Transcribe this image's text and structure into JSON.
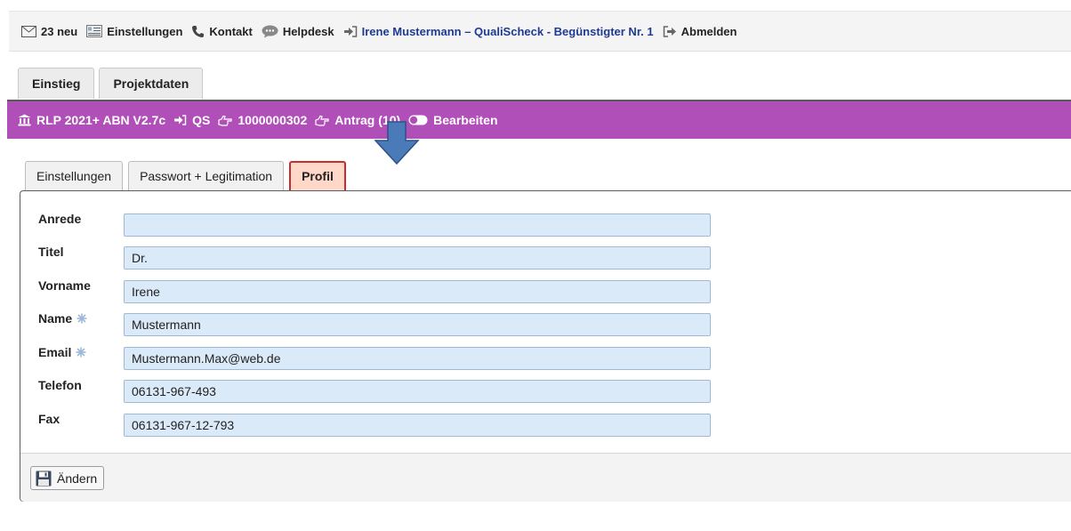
{
  "topbar": {
    "messages": "23 neu",
    "settings": "Einstellungen",
    "contact": "Kontakt",
    "helpdesk": "Helpdesk",
    "user": "Irene Mustermann – QualiScheck - Begünstigter Nr. 1",
    "logout": "Abmelden"
  },
  "top_tabs": [
    "Einstieg",
    "Projektdaten"
  ],
  "breadcrumb": {
    "program": "RLP 2021+ ABN V2.7c",
    "module": "QS",
    "number": "1000000302",
    "application": "Antrag (10)",
    "mode": "Bearbeiten"
  },
  "sub_tabs": [
    "Einstellungen",
    "Passwort + Legitimation",
    "Profil"
  ],
  "form": {
    "fields": [
      {
        "label": "Anrede",
        "value": "",
        "required": false
      },
      {
        "label": "Titel",
        "value": "Dr.",
        "required": false
      },
      {
        "label": "Vorname",
        "value": "Irene",
        "required": false
      },
      {
        "label": "Name",
        "value": "Mustermann",
        "required": true
      },
      {
        "label": "Email",
        "value": "Mustermann.Max@web.de",
        "required": true
      },
      {
        "label": "Telefon",
        "value": "06131-967-493",
        "required": false
      },
      {
        "label": "Fax",
        "value": "06131-967-12-793",
        "required": false
      }
    ],
    "save_label": "Ändern"
  },
  "colors": {
    "purple_bar": "#b04fb8",
    "user_link": "#1f3a93",
    "field_bg": "#dbeaf9",
    "active_tab_bg": "#ffd8c9",
    "active_tab_border": "#c62d2d",
    "arrow": "#4a7ab8"
  },
  "icons": [
    "envelope-icon",
    "settings-list-icon",
    "phone-icon",
    "chat-bubble-icon",
    "sign-in-icon",
    "sign-out-icon",
    "bank-icon",
    "pointing-hand-icon",
    "toggle-icon",
    "asterisk-icon",
    "floppy-disk-icon",
    "down-arrow-icon"
  ]
}
